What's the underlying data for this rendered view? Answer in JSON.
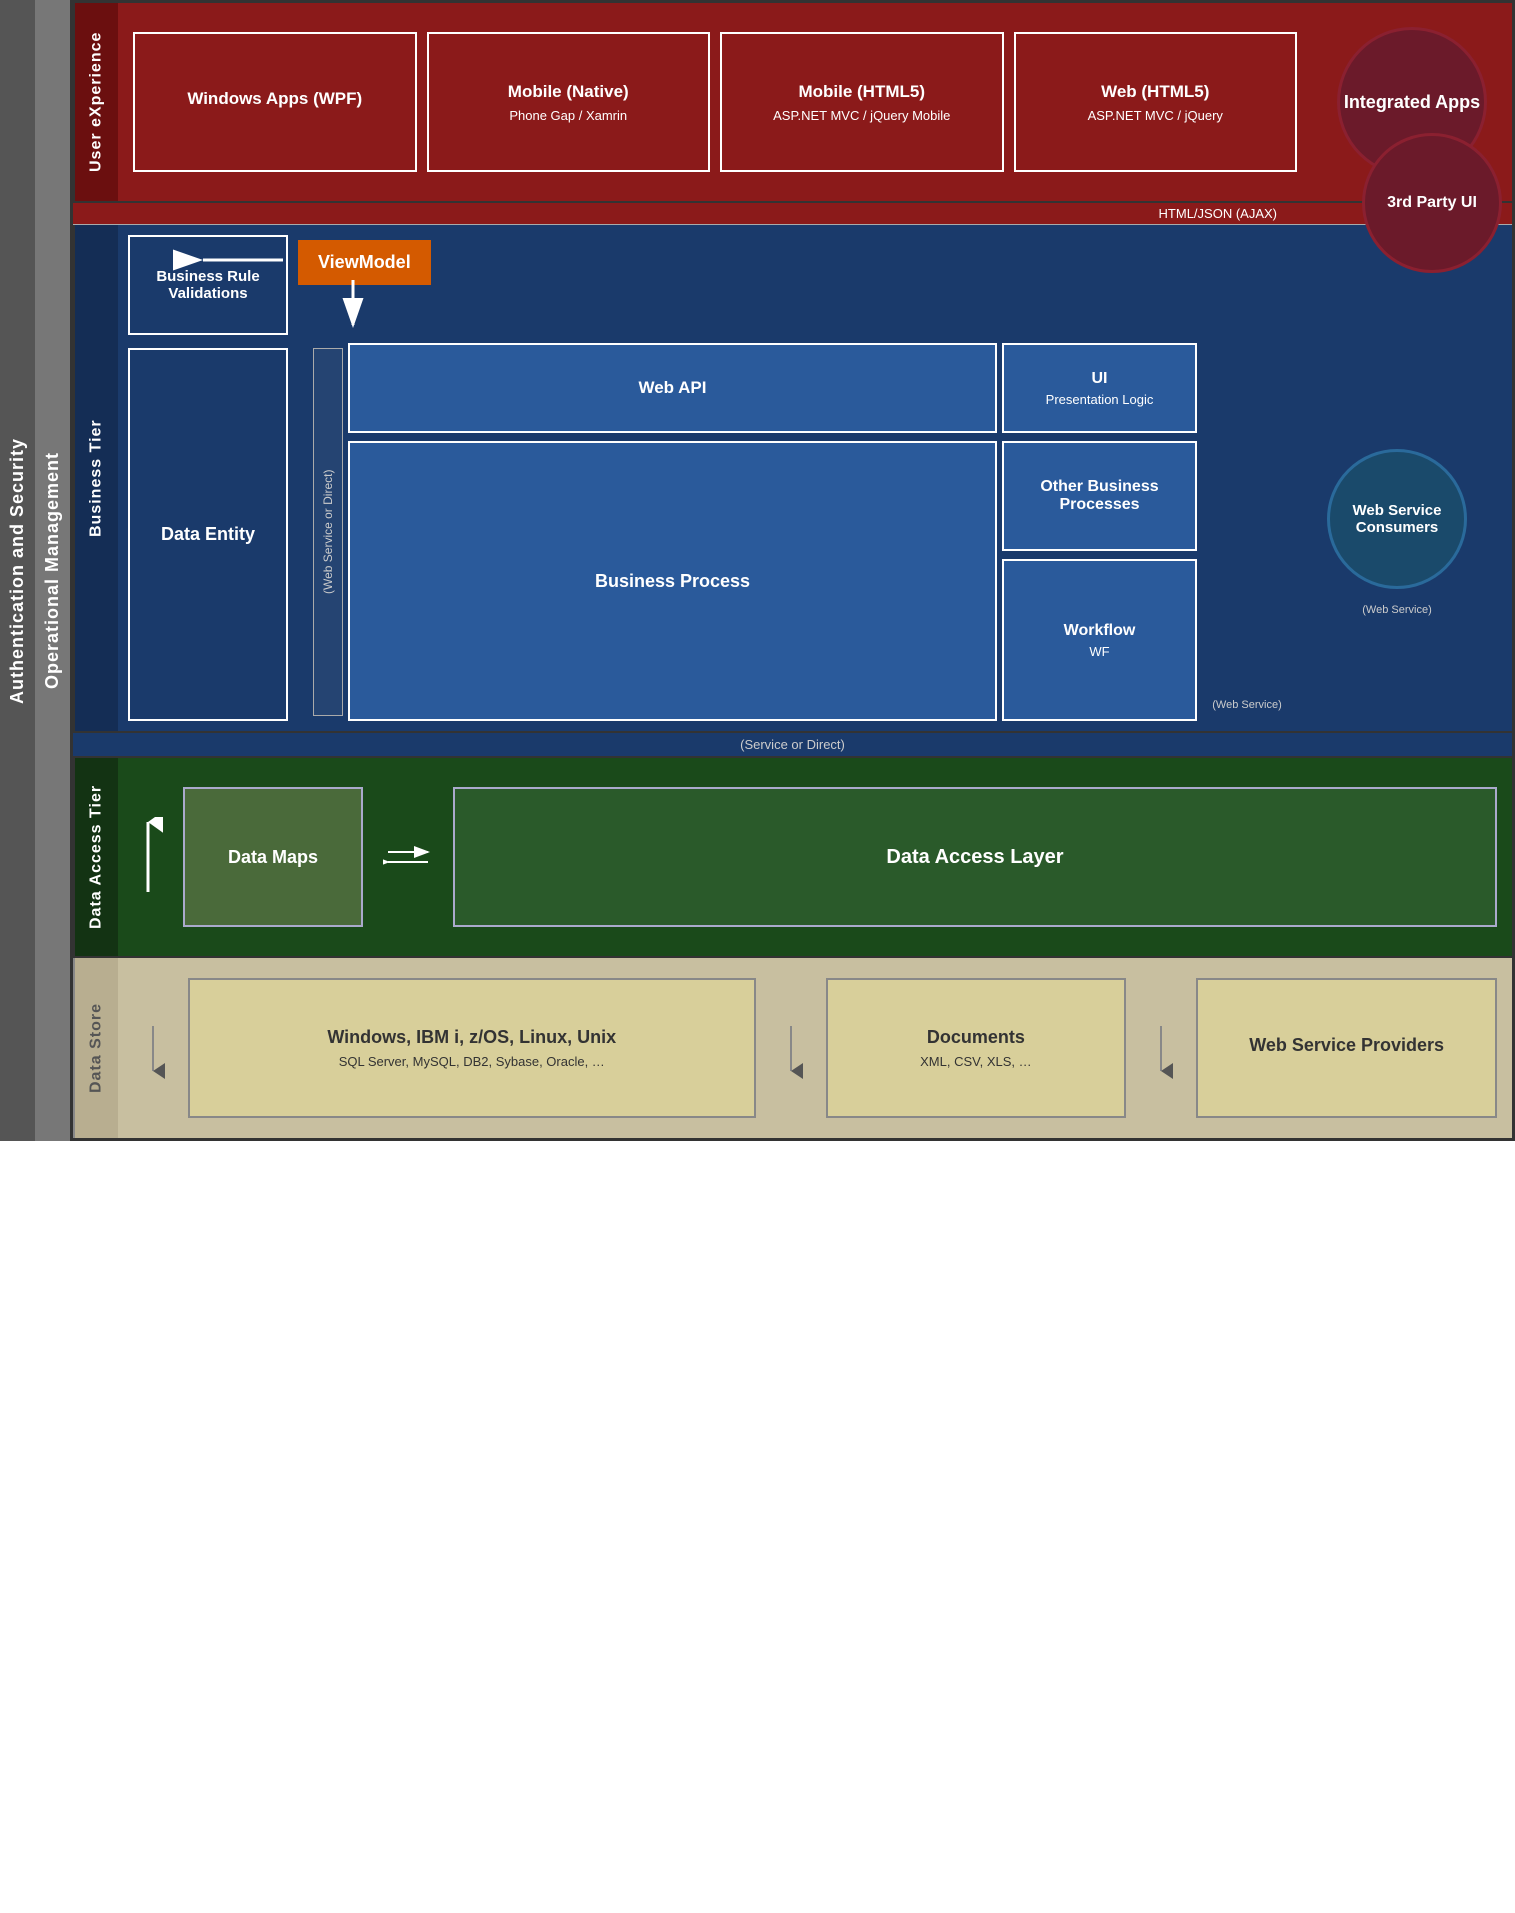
{
  "leftLabels": {
    "auth": "Authentication and Security",
    "ops": "Operational Management"
  },
  "uxRow": {
    "label": "User eXperience",
    "cards": [
      {
        "title": "Windows Apps (WPF)",
        "subtitle": ""
      },
      {
        "title": "Mobile (Native)",
        "subtitle": "Phone Gap / Xamrin"
      },
      {
        "title": "Mobile (HTML5)",
        "subtitle": "ASP.NET MVC / jQuery Mobile"
      },
      {
        "title": "Web (HTML5)",
        "subtitle": "ASP.NET MVC / jQuery"
      }
    ],
    "ajaxLabel": "HTML/JSON (AJAX)",
    "integratedApps": "Integrated Apps",
    "thirdPartyUI": "3rd Party UI"
  },
  "businessRow": {
    "label": "Business Tier",
    "viewModel": "ViewModel",
    "businessRuleValidations": "Business Rule Validations",
    "dataEntity": "Data Entity",
    "webAPI": "Web API",
    "wsOrDirect": "(Web Service or Direct)",
    "ui": "UI",
    "uiSub": "Presentation Logic",
    "otherBusinessProcesses": "Other Business Processes",
    "workflow": "Workflow",
    "workflowSub": "WF",
    "businessProcess": "Business Process",
    "webService": "(Web Service)",
    "webServiceConsumers": "Web Service Consumers",
    "webServiceNote": "(Web Service)"
  },
  "datRow": {
    "label": "Data Access Tier",
    "serviceOrDirect": "(Service or Direct)",
    "dataMaps": "Data Maps",
    "dataAccessLayer": "Data Access Layer"
  },
  "dataStore": {
    "label": "Data Store",
    "windows": {
      "title": "Windows, IBM i, z/OS, Linux, Unix",
      "subtitle": "SQL Server, MySQL, DB2, Sybase, Oracle, …"
    },
    "documents": {
      "title": "Documents",
      "subtitle": "XML, CSV, XLS, …"
    },
    "webServiceProviders": {
      "title": "Web Service Providers",
      "subtitle": ""
    }
  }
}
